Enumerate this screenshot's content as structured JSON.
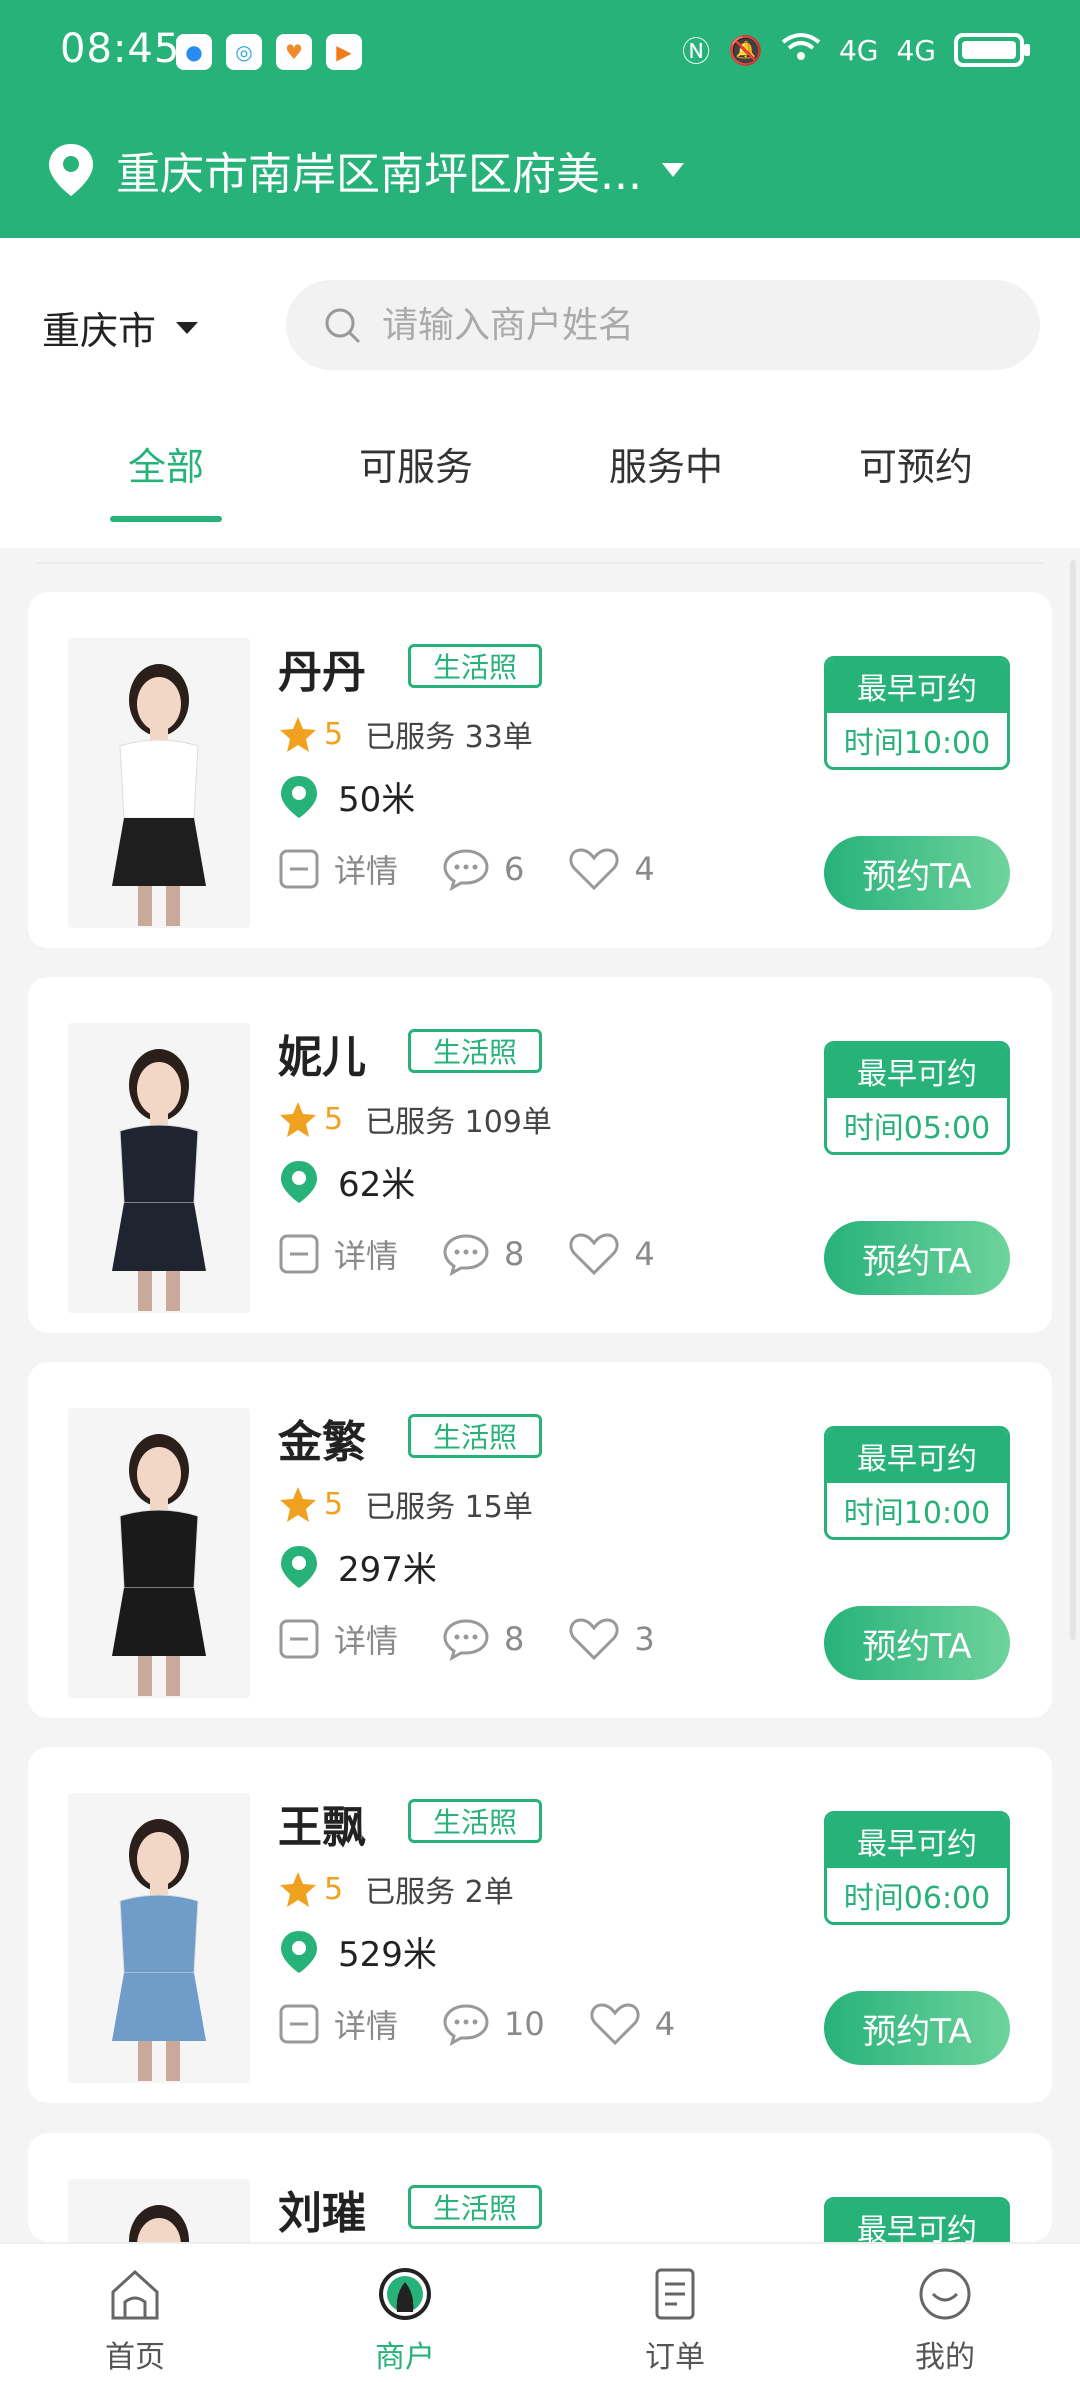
{
  "status": {
    "time": "08:45",
    "signal": "4G"
  },
  "location": {
    "text": "重庆市南岸区南坪区府美..."
  },
  "city": {
    "label": "重庆市"
  },
  "search": {
    "placeholder": "请输入商户姓名"
  },
  "tabs": [
    {
      "label": "全部",
      "active": true
    },
    {
      "label": "可服务",
      "active": false
    },
    {
      "label": "服务中",
      "active": false
    },
    {
      "label": "可预约",
      "active": false
    }
  ],
  "cards": [
    {
      "name": "丹丹",
      "tag": "生活照",
      "rating": "5",
      "served": "已服务 33单",
      "distance": "50米",
      "detail": "详情",
      "comments": "6",
      "likes": "4",
      "slot_title": "最早可约",
      "slot_time": "时间10:00",
      "book": "预约TA",
      "shirt": "#ffffff",
      "skirt": "#1e1e1e"
    },
    {
      "name": "妮儿",
      "tag": "生活照",
      "rating": "5",
      "served": "已服务 109单",
      "distance": "62米",
      "detail": "详情",
      "comments": "8",
      "likes": "4",
      "slot_title": "最早可约",
      "slot_time": "时间05:00",
      "book": "预约TA",
      "shirt": "#1f2430",
      "skirt": "#1f2430"
    },
    {
      "name": "金繁",
      "tag": "生活照",
      "rating": "5",
      "served": "已服务 15单",
      "distance": "297米",
      "detail": "详情",
      "comments": "8",
      "likes": "3",
      "slot_title": "最早可约",
      "slot_time": "时间10:00",
      "book": "预约TA",
      "shirt": "#1a1a1a",
      "skirt": "#1a1a1a"
    },
    {
      "name": "王飘",
      "tag": "生活照",
      "rating": "5",
      "served": "已服务 2单",
      "distance": "529米",
      "detail": "详情",
      "comments": "10",
      "likes": "4",
      "slot_title": "最早可约",
      "slot_time": "时间06:00",
      "book": "预约TA",
      "shirt": "#6f9cc9",
      "skirt": "#6f9cc9"
    },
    {
      "name": "刘璀",
      "tag": "生活照",
      "rating": "",
      "served": "",
      "distance": "",
      "detail": "",
      "comments": "",
      "likes": "",
      "slot_title": "最早可约",
      "slot_time": "",
      "book": "",
      "shirt": "#ffffff",
      "skirt": "#ffffff"
    }
  ],
  "nav": [
    {
      "label": "首页",
      "icon": "home-icon",
      "active": false
    },
    {
      "label": "商户",
      "icon": "merchant-icon",
      "active": true
    },
    {
      "label": "订单",
      "icon": "order-icon",
      "active": false
    },
    {
      "label": "我的",
      "icon": "profile-icon",
      "active": false
    }
  ],
  "colors": {
    "brand": "#27b27a",
    "star": "#f0a11f"
  }
}
